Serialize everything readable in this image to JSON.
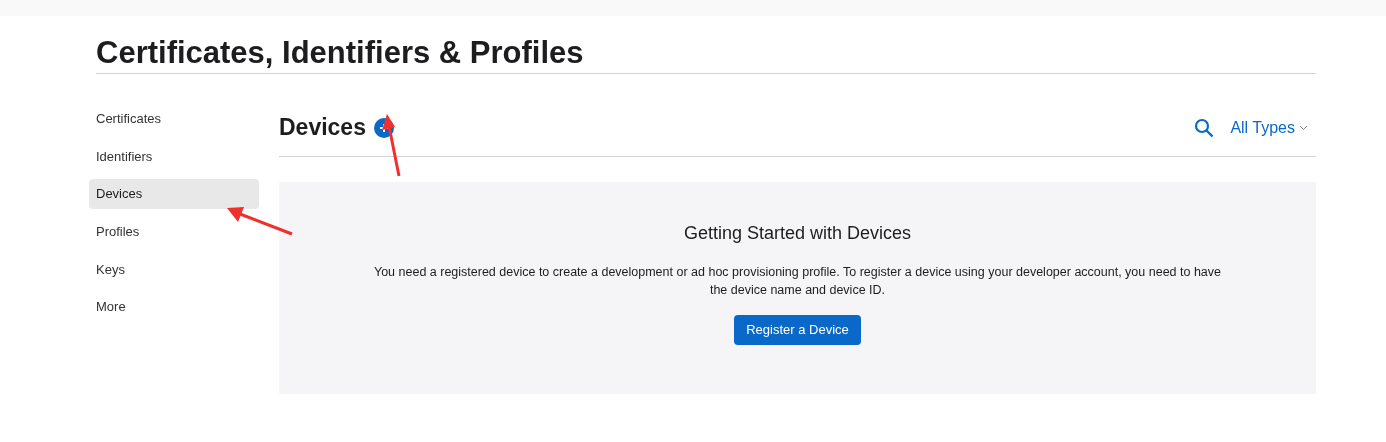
{
  "page_title": "Certificates, Identifiers & Profiles",
  "sidebar": {
    "items": [
      {
        "label": "Certificates",
        "selected": false
      },
      {
        "label": "Identifiers",
        "selected": false
      },
      {
        "label": "Devices",
        "selected": true
      },
      {
        "label": "Profiles",
        "selected": false
      },
      {
        "label": "Keys",
        "selected": false
      },
      {
        "label": "More",
        "selected": false
      }
    ]
  },
  "section": {
    "title": "Devices",
    "filter": "All Types"
  },
  "empty_state": {
    "heading": "Getting Started with Devices",
    "text": "You need a registered device to create a development or ad hoc provisioning profile. To register a device using your developer account, you need to have the device name and device ID.",
    "button": "Register a Device"
  }
}
